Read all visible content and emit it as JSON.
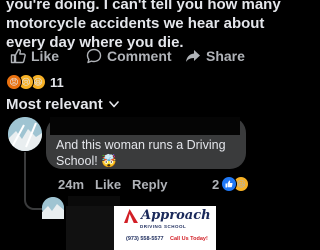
{
  "post": {
    "text_lines": [
      "you're doing. I can't tell you how many",
      "motorcycle accidents we hear about",
      "every day where you die."
    ]
  },
  "actions": {
    "like_label": "Like",
    "comment_label": "Comment",
    "share_label": "Share"
  },
  "reactions": {
    "count": "11",
    "icons": [
      "angry-reaction",
      "sad-reaction",
      "haha-reaction"
    ]
  },
  "sort": {
    "label": "Most relevant"
  },
  "comment": {
    "text": "And this woman runs a Driving School! 🤯",
    "time": "24m",
    "like_label": "Like",
    "reply_label": "Reply",
    "reaction_count": "2",
    "reaction_icons": [
      "like-reaction",
      "haha-reaction"
    ]
  },
  "reply": {
    "image": {
      "brand": "Approach",
      "subtitle": "DRIVING SCHOOL",
      "phone": "(973) 558-5577",
      "cta": "Call Us Today!"
    }
  },
  "colors": {
    "background": "#000000",
    "text": "#e4e6eb",
    "muted": "#b0b3b8",
    "bubble": "#3a3b3c",
    "like_blue": "#2078f4",
    "brand_red": "#d21f26",
    "brand_navy": "#1b2a5b"
  }
}
